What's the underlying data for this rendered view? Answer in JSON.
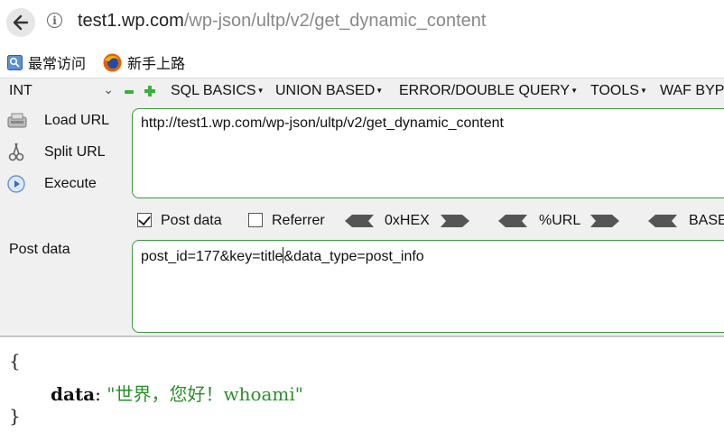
{
  "browser": {
    "url_host": "test1.wp.com",
    "url_path": "/wp-json/ultp/v2/get_dynamic_content",
    "bookmarks": [
      {
        "label": "最常访问",
        "icon": "bookmark-folder-icon"
      },
      {
        "label": "新手上路",
        "icon": "firefox-icon"
      }
    ]
  },
  "hackbar": {
    "select_value": "INT",
    "menus": [
      "SQL BASICS",
      "UNION BASED",
      "ERROR/DOUBLE QUERY",
      "TOOLS",
      "WAF BYP"
    ],
    "side_buttons": {
      "load_url": "Load URL",
      "split_url": "Split URL",
      "execute": "Execute"
    },
    "url_value": "http://test1.wp.com/wp-json/ultp/v2/get_dynamic_content",
    "options": {
      "post_data": {
        "label": "Post data",
        "checked": true
      },
      "referrer": {
        "label": "Referrer",
        "checked": false
      },
      "hex": "0xHEX",
      "url": "%URL",
      "base": "BASE"
    },
    "post_label": "Post data",
    "post_value_before_caret": "post_id=177&key=title",
    "post_value_after_caret": "&data_type=post_info"
  },
  "response": {
    "open_brace": "{",
    "key": "data",
    "separator": ":",
    "value": "\"世界，您好！whoami\"",
    "close_brace": "}"
  },
  "colors": {
    "accent_green": "#3c9b3c",
    "value_green": "#2a8f2a"
  }
}
